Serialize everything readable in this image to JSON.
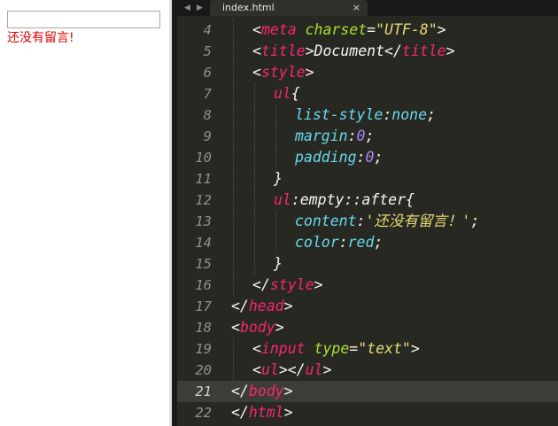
{
  "preview": {
    "input_value": "",
    "empty_message": "还没有留言!"
  },
  "editor": {
    "tab_title": "index.html",
    "tab_close": "×",
    "nav_left": "◀",
    "nav_right": "▶",
    "current_line": 21,
    "colors": {
      "background": "#272822",
      "tag": "#f92672",
      "attribute": "#a6e22e",
      "string": "#e6db74",
      "property": "#66d9ef",
      "number": "#ae81ff",
      "plain": "#f8f8f2"
    },
    "lines": [
      {
        "n": "4",
        "indent": 1,
        "tokens": [
          {
            "t": "<",
            "c": "pw"
          },
          {
            "t": "meta",
            "c": "pk"
          },
          {
            "t": " ",
            "c": "pw"
          },
          {
            "t": "charset",
            "c": "pg"
          },
          {
            "t": "=",
            "c": "pw"
          },
          {
            "t": "\"UTF-8\"",
            "c": "py"
          },
          {
            "t": ">",
            "c": "pw"
          }
        ]
      },
      {
        "n": "5",
        "indent": 1,
        "tokens": [
          {
            "t": "<",
            "c": "pw"
          },
          {
            "t": "title",
            "c": "pk"
          },
          {
            "t": ">Document</",
            "c": "pw"
          },
          {
            "t": "title",
            "c": "pk"
          },
          {
            "t": ">",
            "c": "pw"
          }
        ]
      },
      {
        "n": "6",
        "indent": 1,
        "tokens": [
          {
            "t": "<",
            "c": "pw"
          },
          {
            "t": "style",
            "c": "pk"
          },
          {
            "t": ">",
            "c": "pw"
          }
        ]
      },
      {
        "n": "7",
        "indent": 2,
        "tokens": [
          {
            "t": "ul",
            "c": "pk"
          },
          {
            "t": "{",
            "c": "pw"
          }
        ]
      },
      {
        "n": "8",
        "indent": 3,
        "tokens": [
          {
            "t": "list-style",
            "c": "pc"
          },
          {
            "t": ":",
            "c": "pw"
          },
          {
            "t": "none",
            "c": "pc"
          },
          {
            "t": ";",
            "c": "pw"
          }
        ]
      },
      {
        "n": "9",
        "indent": 3,
        "tokens": [
          {
            "t": "margin",
            "c": "pc"
          },
          {
            "t": ":",
            "c": "pw"
          },
          {
            "t": "0",
            "c": "pp"
          },
          {
            "t": ";",
            "c": "pw"
          }
        ]
      },
      {
        "n": "10",
        "indent": 3,
        "tokens": [
          {
            "t": "padding",
            "c": "pc"
          },
          {
            "t": ":",
            "c": "pw"
          },
          {
            "t": "0",
            "c": "pp"
          },
          {
            "t": ";",
            "c": "pw"
          }
        ]
      },
      {
        "n": "11",
        "indent": 2,
        "tokens": [
          {
            "t": "}",
            "c": "pw"
          }
        ]
      },
      {
        "n": "12",
        "indent": 2,
        "tokens": [
          {
            "t": "ul",
            "c": "pk"
          },
          {
            "t": ":empty::after{",
            "c": "pw"
          }
        ]
      },
      {
        "n": "13",
        "indent": 3,
        "tokens": [
          {
            "t": "content",
            "c": "pc"
          },
          {
            "t": ":",
            "c": "pw"
          },
          {
            "t": "'还没有留言！'",
            "c": "py"
          },
          {
            "t": ";",
            "c": "pw"
          }
        ]
      },
      {
        "n": "14",
        "indent": 3,
        "tokens": [
          {
            "t": "color",
            "c": "pc"
          },
          {
            "t": ":",
            "c": "pw"
          },
          {
            "t": "red",
            "c": "pc"
          },
          {
            "t": ";",
            "c": "pw"
          }
        ]
      },
      {
        "n": "15",
        "indent": 2,
        "tokens": [
          {
            "t": "}",
            "c": "pw"
          }
        ]
      },
      {
        "n": "16",
        "indent": 1,
        "tokens": [
          {
            "t": "</",
            "c": "pw"
          },
          {
            "t": "style",
            "c": "pk"
          },
          {
            "t": ">",
            "c": "pw"
          }
        ]
      },
      {
        "n": "17",
        "indent": 0,
        "tokens": [
          {
            "t": "</",
            "c": "pw"
          },
          {
            "t": "head",
            "c": "pk"
          },
          {
            "t": ">",
            "c": "pw"
          }
        ]
      },
      {
        "n": "18",
        "indent": 0,
        "tokens": [
          {
            "t": "<",
            "c": "pw"
          },
          {
            "t": "body",
            "c": "pk"
          },
          {
            "t": ">",
            "c": "pw"
          }
        ]
      },
      {
        "n": "19",
        "indent": 1,
        "tokens": [
          {
            "t": "<",
            "c": "pw"
          },
          {
            "t": "input",
            "c": "pk"
          },
          {
            "t": " ",
            "c": "pw"
          },
          {
            "t": "type",
            "c": "pg"
          },
          {
            "t": "=",
            "c": "pw"
          },
          {
            "t": "\"text\"",
            "c": "py"
          },
          {
            "t": ">",
            "c": "pw"
          }
        ]
      },
      {
        "n": "20",
        "indent": 1,
        "tokens": [
          {
            "t": "<",
            "c": "pw"
          },
          {
            "t": "ul",
            "c": "pk"
          },
          {
            "t": "></",
            "c": "pw"
          },
          {
            "t": "ul",
            "c": "pk"
          },
          {
            "t": ">",
            "c": "pw"
          }
        ]
      },
      {
        "n": "21",
        "indent": 0,
        "tokens": [
          {
            "t": "</",
            "c": "pw"
          },
          {
            "t": "body",
            "c": "pk"
          },
          {
            "t": ">",
            "c": "pw"
          }
        ]
      },
      {
        "n": "22",
        "indent": 0,
        "tokens": [
          {
            "t": "</",
            "c": "pw"
          },
          {
            "t": "html",
            "c": "pk"
          },
          {
            "t": ">",
            "c": "pw"
          }
        ]
      }
    ]
  }
}
